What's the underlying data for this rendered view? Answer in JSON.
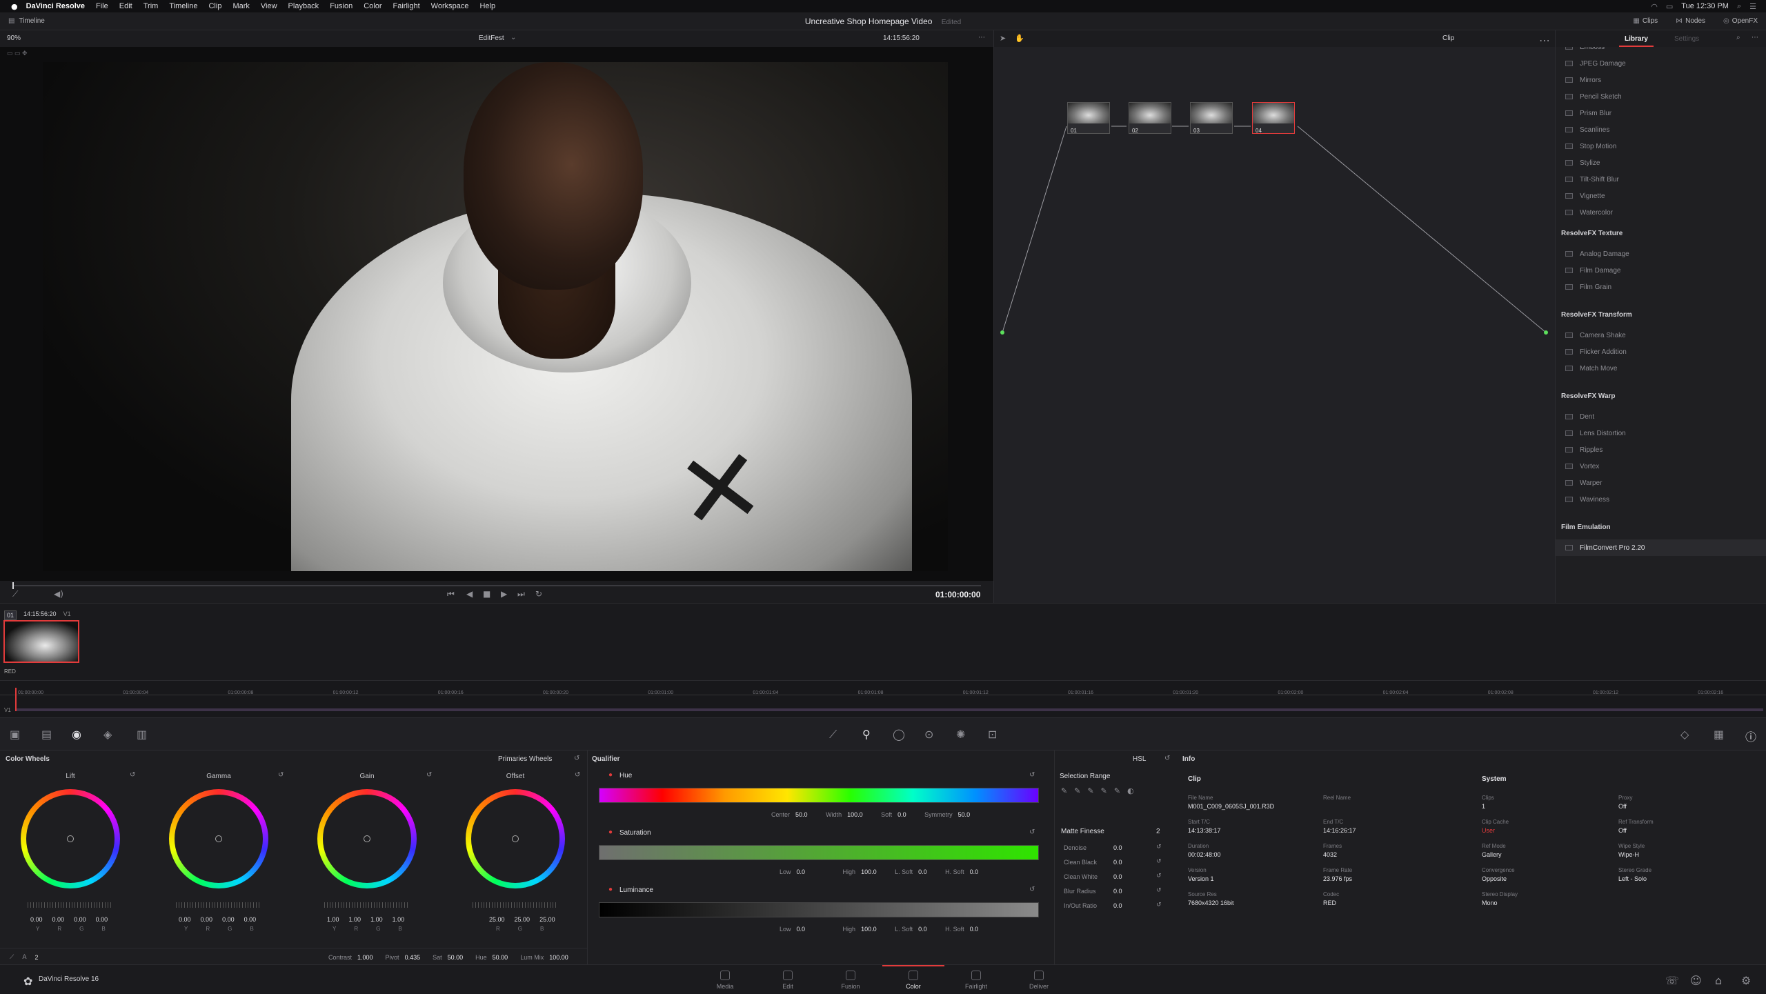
{
  "menubar": {
    "app": "DaVinci Resolve",
    "items": [
      "File",
      "Edit",
      "Trim",
      "Timeline",
      "Clip",
      "Mark",
      "View",
      "Playback",
      "Fusion",
      "Color",
      "Fairlight",
      "Workspace",
      "Help"
    ],
    "clock": "Tue 12:30 PM"
  },
  "titlebar": {
    "timeline_label": "Timeline",
    "project": "Uncreative Shop Homepage Video",
    "status": "Edited",
    "clips": "Clips",
    "nodes": "Nodes",
    "openfx": "OpenFX"
  },
  "viewer": {
    "zoom": "90%",
    "clip_name": "EditFest",
    "timecode": "14:15:56:20",
    "mode": "Clip",
    "playhead": "01:00:00:00"
  },
  "nodes": [
    {
      "label": "01"
    },
    {
      "label": "02"
    },
    {
      "label": "03"
    },
    {
      "label": "04"
    }
  ],
  "library": {
    "tab_library": "Library",
    "tab_settings": "Settings",
    "stylize_items": [
      "Emboss",
      "JPEG Damage",
      "Mirrors",
      "Pencil Sketch",
      "Prism Blur",
      "Scanlines",
      "Stop Motion",
      "Stylize",
      "Tilt-Shift Blur",
      "Vignette",
      "Watercolor"
    ],
    "groups": [
      {
        "title": "ResolveFX Texture",
        "items": [
          "Analog Damage",
          "Film Damage",
          "Film Grain"
        ]
      },
      {
        "title": "ResolveFX Transform",
        "items": [
          "Camera Shake",
          "Flicker Addition",
          "Match Move"
        ]
      },
      {
        "title": "ResolveFX Warp",
        "items": [
          "Dent",
          "Lens Distortion",
          "Ripples",
          "Vortex",
          "Warper",
          "Waviness"
        ]
      },
      {
        "title": "Film Emulation",
        "items": [
          "FilmConvert Pro 2.20"
        ]
      }
    ]
  },
  "clip": {
    "index": "01",
    "timecode": "14:15:56:20",
    "track": "V1",
    "codec": "RED"
  },
  "timeline": {
    "track": "V1",
    "ticks": [
      "01:00:00:00",
      "01:00:00:04",
      "01:00:00:08",
      "01:00:00:12",
      "01:00:00:16",
      "01:00:00:20",
      "01:00:01:00",
      "01:00:01:04",
      "01:00:01:08",
      "01:00:01:12",
      "01:00:01:16",
      "01:00:01:20",
      "01:00:02:00",
      "01:00:02:04",
      "01:00:02:08",
      "01:00:02:12",
      "01:00:02:16"
    ]
  },
  "colorwheels": {
    "title": "Color Wheels",
    "mode": "Primaries Wheels",
    "wheels": [
      {
        "name": "Lift",
        "values": [
          "0.00",
          "0.00",
          "0.00",
          "0.00"
        ],
        "sub": [
          "Y",
          "R",
          "G",
          "B"
        ]
      },
      {
        "name": "Gamma",
        "values": [
          "0.00",
          "0.00",
          "0.00",
          "0.00"
        ],
        "sub": [
          "Y",
          "R",
          "G",
          "B"
        ]
      },
      {
        "name": "Gain",
        "values": [
          "1.00",
          "1.00",
          "1.00",
          "1.00"
        ],
        "sub": [
          "Y",
          "R",
          "G",
          "B"
        ]
      },
      {
        "name": "Offset",
        "values": [
          "25.00",
          "25.00",
          "25.00"
        ],
        "sub": [
          "R",
          "G",
          "B"
        ]
      }
    ],
    "footer": {
      "page": "2",
      "contrast_label": "Contrast",
      "contrast": "1.000",
      "pivot_label": "Pivot",
      "pivot": "0.435",
      "sat_label": "Sat",
      "sat": "50.00",
      "hue_label": "Hue",
      "hue": "50.00",
      "lummix_label": "Lum Mix",
      "lummix": "100.00"
    }
  },
  "qualifier": {
    "title": "Qualifier",
    "mode": "HSL",
    "hue": {
      "label": "Hue",
      "center": "50.0",
      "width": "100.0",
      "soft": "0.0",
      "symmetry": "50.0"
    },
    "saturation": {
      "label": "Saturation",
      "low": "0.0",
      "high": "100.0",
      "lsoft": "0.0",
      "hsoft": "0.0"
    },
    "luminance": {
      "label": "Luminance",
      "low": "0.0",
      "high": "100.0",
      "lsoft": "0.0",
      "hsoft": "0.0"
    },
    "labels": {
      "center": "Center",
      "width": "Width",
      "soft": "Soft",
      "symmetry": "Symmetry",
      "low": "Low",
      "high": "High",
      "lsoft": "L. Soft",
      "hsoft": "H. Soft"
    },
    "selection_range": "Selection Range",
    "matte_finesse": "Matte Finesse",
    "matte_page": "2",
    "matte": [
      {
        "label": "Denoise",
        "value": "0.0"
      },
      {
        "label": "Clean Black",
        "value": "0.0"
      },
      {
        "label": "Clean White",
        "value": "0.0"
      },
      {
        "label": "Blur Radius",
        "value": "0.0"
      },
      {
        "label": "In/Out Ratio",
        "value": "0.0"
      }
    ]
  },
  "info": {
    "title": "Info",
    "clip_section": "Clip",
    "system_section": "System",
    "clip_fields": [
      {
        "k": "File Name",
        "v": "M001_C009_0605SJ_001.R3D"
      },
      {
        "k": "Reel Name",
        "v": ""
      },
      {
        "k": "Start T/C",
        "v": "14:13:38:17"
      },
      {
        "k": "End T/C",
        "v": "14:16:26:17"
      },
      {
        "k": "Duration",
        "v": "00:02:48:00"
      },
      {
        "k": "Frames",
        "v": "4032"
      },
      {
        "k": "Version",
        "v": "Version 1"
      },
      {
        "k": "Frame Rate",
        "v": "23.976 fps"
      },
      {
        "k": "Source Res",
        "v": "7680x4320 16bit"
      },
      {
        "k": "Codec",
        "v": "RED"
      }
    ],
    "system_fields": [
      {
        "k": "Clips",
        "v": "1"
      },
      {
        "k": "Proxy",
        "v": "Off"
      },
      {
        "k": "Clip Cache",
        "v": "User"
      },
      {
        "k": "Ref Transform",
        "v": "Off"
      },
      {
        "k": "Ref Mode",
        "v": "Gallery"
      },
      {
        "k": "Wipe Style",
        "v": "Wipe-H"
      },
      {
        "k": "Convergence",
        "v": "Opposite"
      },
      {
        "k": "Stereo Grade",
        "v": "Left - Solo"
      },
      {
        "k": "Stereo Display",
        "v": "Mono"
      }
    ]
  },
  "pages": [
    "Media",
    "Edit",
    "Fusion",
    "Color",
    "Fairlight",
    "Deliver"
  ],
  "active_page": "Color",
  "bottom_app": "DaVinci Resolve 16",
  "accent": "#e23b3b"
}
